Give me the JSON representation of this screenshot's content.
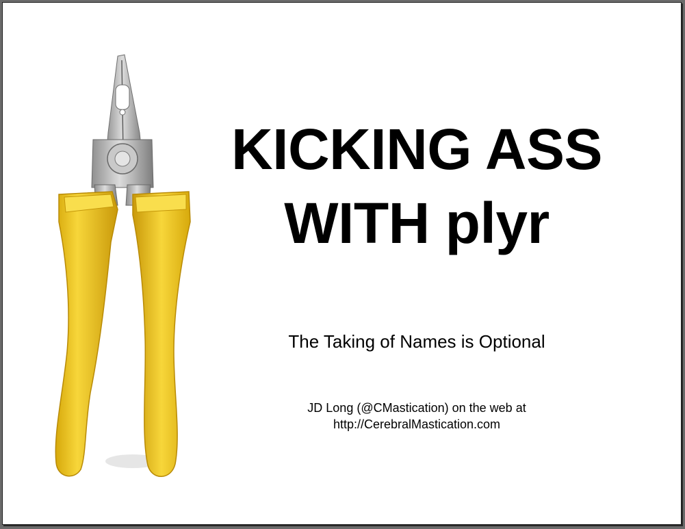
{
  "slide": {
    "title_line1": "KICKING ASS",
    "title_line2": "WITH plyr",
    "subtitle": "The Taking of Names is Optional",
    "author_line1": "JD Long (@CMastication) on the web at",
    "author_line2": "http://CerebralMastication.com"
  },
  "image": {
    "icon": "pliers-icon",
    "handle_color": "#f2cc1f",
    "metal_color": "#b9b9b9"
  }
}
